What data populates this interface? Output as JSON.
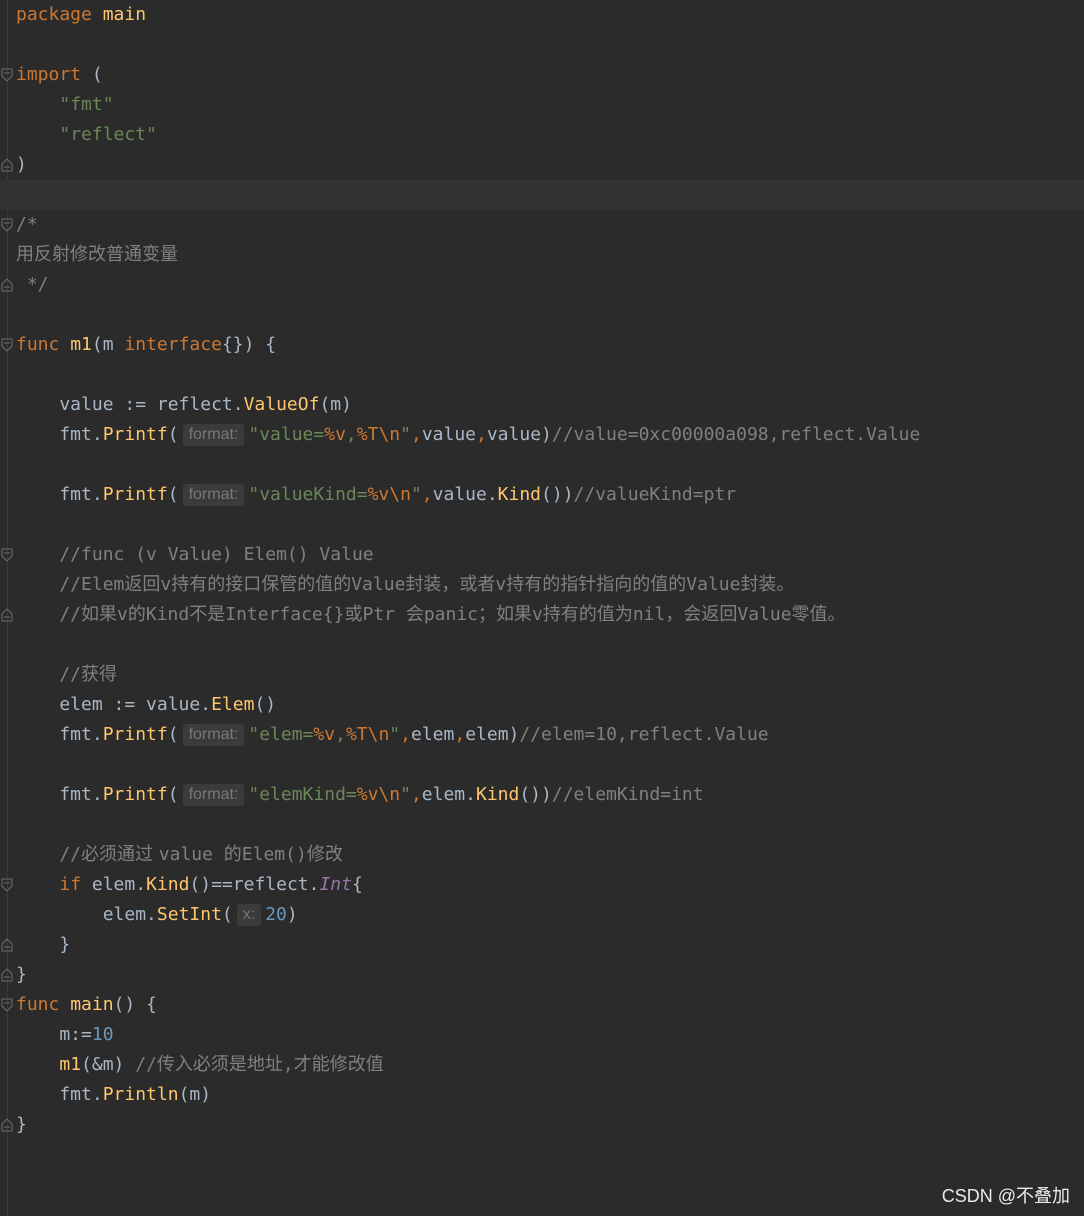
{
  "editor": {
    "language": "Go",
    "theme_colors": {
      "background": "#2b2b2b",
      "keyword": "#cc7832",
      "function": "#ffc66d",
      "string": "#6a8759",
      "number": "#6897bb",
      "comment": "#808080",
      "default": "#a9b7c6"
    },
    "lines": [
      [
        {
          "t": "package ",
          "c": "kw"
        },
        {
          "t": "main",
          "c": "fn"
        }
      ],
      [],
      [
        {
          "t": "import ",
          "c": "kw"
        },
        {
          "t": "("
        }
      ],
      [
        {
          "t": "    "
        },
        {
          "t": "\"fmt\"",
          "c": "str"
        }
      ],
      [
        {
          "t": "    "
        },
        {
          "t": "\"reflect\"",
          "c": "str"
        }
      ],
      [
        {
          "t": ")"
        }
      ],
      [],
      [
        {
          "t": "/*",
          "c": "cmt"
        }
      ],
      [
        {
          "t": "用反射修改普通变量",
          "c": "cmt-cjk"
        }
      ],
      [
        {
          "t": " */",
          "c": "cmt"
        }
      ],
      [],
      [
        {
          "t": "func ",
          "c": "kw"
        },
        {
          "t": "m1",
          "c": "fn"
        },
        {
          "t": "(m "
        },
        {
          "t": "interface",
          "c": "kw"
        },
        {
          "t": "{}) {"
        }
      ],
      [],
      [
        {
          "t": "    value := reflect."
        },
        {
          "t": "ValueOf",
          "c": "fn"
        },
        {
          "t": "(m)"
        }
      ],
      [
        {
          "t": "    fmt."
        },
        {
          "t": "Printf",
          "c": "fn"
        },
        {
          "t": "("
        },
        {
          "hint": "format:"
        },
        {
          "t": "\"value=",
          "c": "str"
        },
        {
          "t": "%v",
          "c": "esc"
        },
        {
          "t": ",",
          "c": "str"
        },
        {
          "t": "%T\\n",
          "c": "esc"
        },
        {
          "t": "\"",
          "c": "str"
        },
        {
          "t": ",",
          "c": "kw"
        },
        {
          "t": "value"
        },
        {
          "t": ",",
          "c": "kw"
        },
        {
          "t": "value)"
        },
        {
          "t": "//value=0xc00000a098,reflect.Value",
          "c": "cmt"
        }
      ],
      [],
      [
        {
          "t": "    fmt."
        },
        {
          "t": "Printf",
          "c": "fn"
        },
        {
          "t": "("
        },
        {
          "hint": "format:"
        },
        {
          "t": "\"valueKind=",
          "c": "str"
        },
        {
          "t": "%v\\n",
          "c": "esc"
        },
        {
          "t": "\"",
          "c": "str"
        },
        {
          "t": ",",
          "c": "kw"
        },
        {
          "t": "value."
        },
        {
          "t": "Kind",
          "c": "fn"
        },
        {
          "t": "())"
        },
        {
          "t": "//valueKind=ptr",
          "c": "cmt"
        }
      ],
      [],
      [
        {
          "t": "    //func (v Value) Elem() Value",
          "c": "cmt"
        }
      ],
      [
        {
          "t": "    //Elem",
          "c": "cmt"
        },
        {
          "t": "返回",
          "c": "cmt-cjk"
        },
        {
          "t": "v",
          "c": "cmt"
        },
        {
          "t": "持有的接口保管的值的",
          "c": "cmt-cjk"
        },
        {
          "t": "Value",
          "c": "cmt"
        },
        {
          "t": "封装，或者",
          "c": "cmt-cjk"
        },
        {
          "t": "v",
          "c": "cmt"
        },
        {
          "t": "持有的指针指向的值的",
          "c": "cmt-cjk"
        },
        {
          "t": "Value",
          "c": "cmt"
        },
        {
          "t": "封装。",
          "c": "cmt-cjk"
        }
      ],
      [
        {
          "t": "    //",
          "c": "cmt"
        },
        {
          "t": "如果",
          "c": "cmt-cjk"
        },
        {
          "t": "v",
          "c": "cmt"
        },
        {
          "t": "的",
          "c": "cmt-cjk"
        },
        {
          "t": "Kind",
          "c": "cmt"
        },
        {
          "t": "不是",
          "c": "cmt-cjk"
        },
        {
          "t": "Interface{}",
          "c": "cmt"
        },
        {
          "t": "或",
          "c": "cmt-cjk"
        },
        {
          "t": "Ptr ",
          "c": "cmt"
        },
        {
          "t": "会",
          "c": "cmt-cjk"
        },
        {
          "t": "panic",
          "c": "cmt"
        },
        {
          "t": "；如果",
          "c": "cmt-cjk"
        },
        {
          "t": "v",
          "c": "cmt"
        },
        {
          "t": "持有的值为",
          "c": "cmt-cjk"
        },
        {
          "t": "nil",
          "c": "cmt"
        },
        {
          "t": "，会返回",
          "c": "cmt-cjk"
        },
        {
          "t": "Value",
          "c": "cmt"
        },
        {
          "t": "零值。",
          "c": "cmt-cjk"
        }
      ],
      [],
      [
        {
          "t": "    //",
          "c": "cmt"
        },
        {
          "t": "获得",
          "c": "cmt-cjk"
        }
      ],
      [
        {
          "t": "    elem := value."
        },
        {
          "t": "Elem",
          "c": "fn"
        },
        {
          "t": "()"
        }
      ],
      [
        {
          "t": "    fmt."
        },
        {
          "t": "Printf",
          "c": "fn"
        },
        {
          "t": "("
        },
        {
          "hint": "format:"
        },
        {
          "t": "\"elem=",
          "c": "str"
        },
        {
          "t": "%v",
          "c": "esc"
        },
        {
          "t": ",",
          "c": "str"
        },
        {
          "t": "%T\\n",
          "c": "esc"
        },
        {
          "t": "\"",
          "c": "str"
        },
        {
          "t": ",",
          "c": "kw"
        },
        {
          "t": "elem"
        },
        {
          "t": ",",
          "c": "kw"
        },
        {
          "t": "elem)"
        },
        {
          "t": "//elem=10,reflect.Value",
          "c": "cmt"
        }
      ],
      [],
      [
        {
          "t": "    fmt."
        },
        {
          "t": "Printf",
          "c": "fn"
        },
        {
          "t": "("
        },
        {
          "hint": "format:"
        },
        {
          "t": "\"elemKind=",
          "c": "str"
        },
        {
          "t": "%v\\n",
          "c": "esc"
        },
        {
          "t": "\"",
          "c": "str"
        },
        {
          "t": ",",
          "c": "kw"
        },
        {
          "t": "elem."
        },
        {
          "t": "Kind",
          "c": "fn"
        },
        {
          "t": "())"
        },
        {
          "t": "//elemKind=int",
          "c": "cmt"
        }
      ],
      [],
      [
        {
          "t": "    //",
          "c": "cmt"
        },
        {
          "t": "必须通过 ",
          "c": "cmt-cjk"
        },
        {
          "t": "value ",
          "c": "cmt"
        },
        {
          "t": "的",
          "c": "cmt-cjk"
        },
        {
          "t": "Elem()",
          "c": "cmt"
        },
        {
          "t": "修改",
          "c": "cmt-cjk"
        }
      ],
      [
        {
          "t": "    "
        },
        {
          "t": "if ",
          "c": "kw"
        },
        {
          "t": "elem."
        },
        {
          "t": "Kind",
          "c": "fn"
        },
        {
          "t": "()==reflect."
        },
        {
          "t": "Int",
          "c": "ital"
        },
        {
          "t": "{"
        }
      ],
      [
        {
          "t": "        elem."
        },
        {
          "t": "SetInt",
          "c": "fn"
        },
        {
          "t": "("
        },
        {
          "hint": "x:"
        },
        {
          "t": "20",
          "c": "num"
        },
        {
          "t": ")"
        }
      ],
      [
        {
          "t": "    }"
        }
      ],
      [
        {
          "t": "}"
        }
      ],
      [
        {
          "t": "func ",
          "c": "kw"
        },
        {
          "t": "main",
          "c": "fn"
        },
        {
          "t": "() {"
        }
      ],
      [
        {
          "t": "    m:="
        },
        {
          "t": "10",
          "c": "num"
        }
      ],
      [
        {
          "t": "    "
        },
        {
          "t": "m1",
          "c": "fn"
        },
        {
          "t": "(&m) "
        },
        {
          "t": "//",
          "c": "cmt"
        },
        {
          "t": "传入必须是地址",
          "c": "cmt-cjk"
        },
        {
          "t": ",",
          "c": "cmt"
        },
        {
          "t": "才能修改值",
          "c": "cmt-cjk"
        }
      ],
      [
        {
          "t": "    fmt."
        },
        {
          "t": "Println",
          "c": "fn"
        },
        {
          "t": "(m)"
        }
      ],
      [
        {
          "t": "}"
        }
      ]
    ],
    "current_line": 6,
    "fold_markers": [
      {
        "line": 2,
        "type": "open"
      },
      {
        "line": 5,
        "type": "close"
      },
      {
        "line": 7,
        "type": "open"
      },
      {
        "line": 9,
        "type": "close"
      },
      {
        "line": 11,
        "type": "open"
      },
      {
        "line": 18,
        "type": "open"
      },
      {
        "line": 20,
        "type": "close"
      },
      {
        "line": 29,
        "type": "open"
      },
      {
        "line": 31,
        "type": "close"
      },
      {
        "line": 32,
        "type": "close"
      },
      {
        "line": 33,
        "type": "open"
      },
      {
        "line": 37,
        "type": "close"
      }
    ]
  },
  "watermark": "CSDN @不叠加"
}
